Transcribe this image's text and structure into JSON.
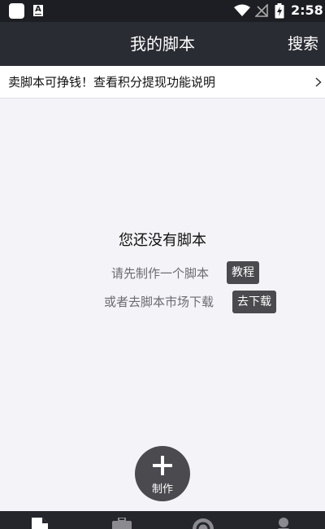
{
  "status_bar": {
    "time": "2:58",
    "icons": [
      "app-notification-icon",
      "a-text-icon",
      "wifi-icon",
      "no-signal-icon",
      "battery-charging-icon"
    ]
  },
  "header": {
    "title": "我的脚本",
    "search_label": "搜索"
  },
  "banner": {
    "text": "卖脚本可挣钱！查看积分提现功能说明",
    "icon": "chevron-right-icon"
  },
  "empty_state": {
    "title": "您还没有脚本",
    "line1": "请先制作一个脚本",
    "tutorial_button": "教程",
    "line2": "或者去脚本市场下载",
    "download_button": "去下载"
  },
  "fab": {
    "label": "制作",
    "icon": "plus-icon"
  },
  "bottom_nav": {
    "items": [
      {
        "icon": "document-icon"
      },
      {
        "icon": "briefcase-icon"
      },
      {
        "icon": "coin-icon"
      },
      {
        "icon": "person-icon"
      }
    ]
  },
  "colors": {
    "header_bg": "#2a2c33",
    "status_bar_bg": "#1d1e24",
    "page_bg": "#f4f3f8",
    "button_bg": "#4a4a4f",
    "nav_bg": "#25262c"
  }
}
